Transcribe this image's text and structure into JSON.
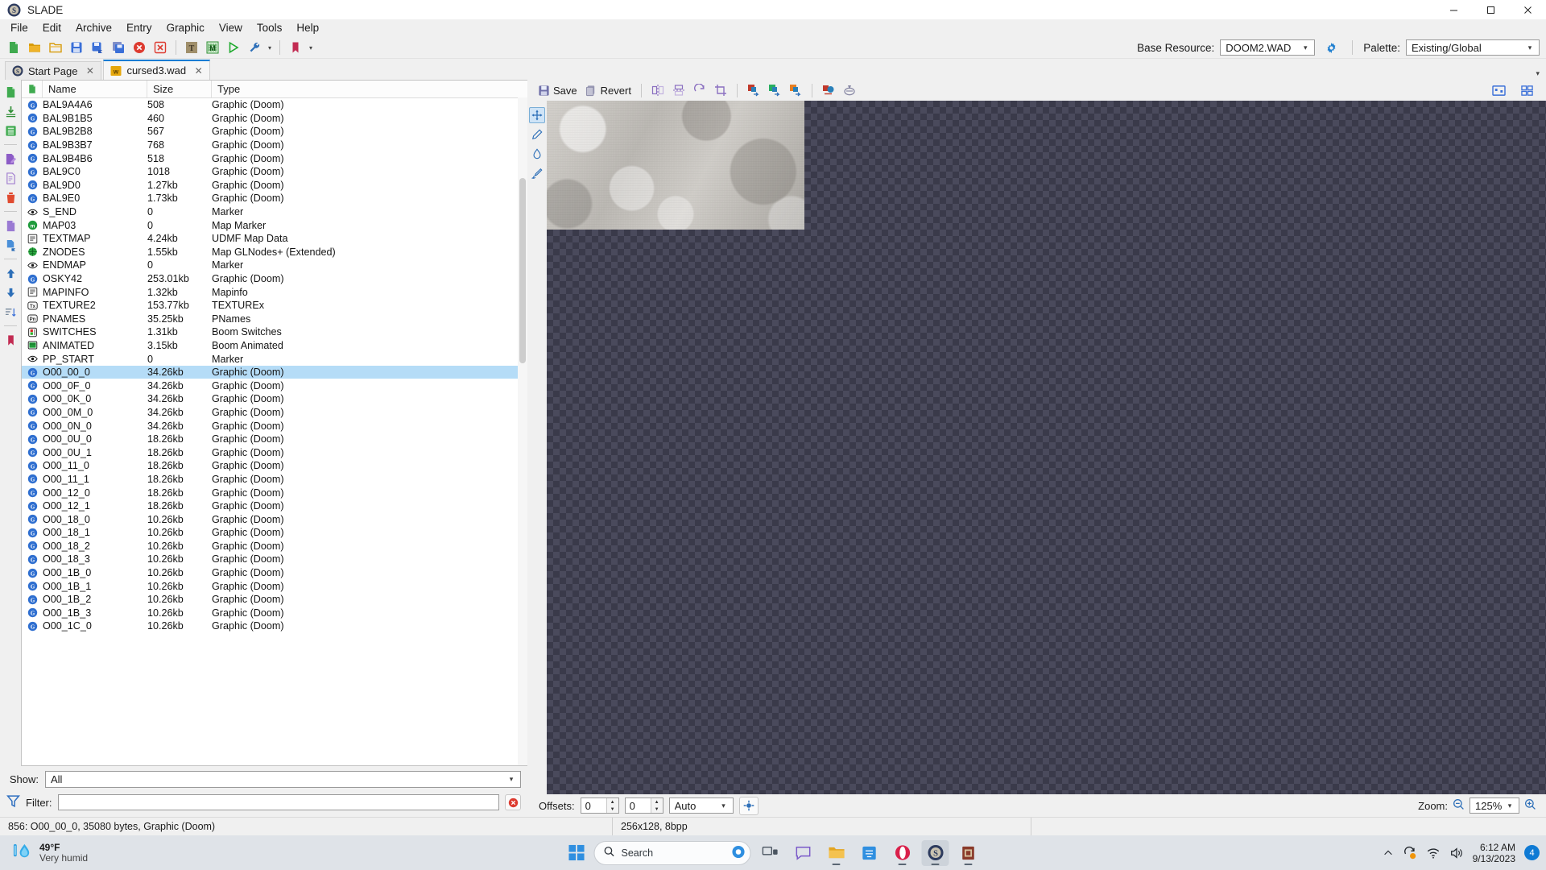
{
  "window": {
    "title": "SLADE",
    "app_icon": "slade-logo-icon",
    "minimize": "–",
    "maximize": "❐",
    "close": "✕"
  },
  "menubar": {
    "items": [
      "File",
      "Edit",
      "Archive",
      "Entry",
      "Graphic",
      "View",
      "Tools",
      "Help"
    ]
  },
  "toolbar": {
    "buttons": [
      {
        "name": "new-archive",
        "icon": "new-file-icon"
      },
      {
        "name": "open-archive",
        "icon": "open-folder-icon"
      },
      {
        "name": "open-directory",
        "icon": "open-folder-outline-icon"
      },
      {
        "name": "save-archive",
        "icon": "save-disk-icon"
      },
      {
        "name": "save-archive-as",
        "icon": "save-as-disk-icon"
      },
      {
        "name": "save-all",
        "icon": "save-all-disk-icon"
      },
      {
        "name": "close-archive",
        "icon": "close-red-circle-icon"
      },
      {
        "name": "close-all-archives",
        "icon": "close-all-red-square-icon"
      },
      {
        "name": "texture-editor",
        "icon": "texture-t-icon"
      },
      {
        "name": "map-editor",
        "icon": "map-m-icon"
      },
      {
        "name": "run-archive",
        "icon": "play-green-icon"
      },
      {
        "name": "preferences",
        "icon": "wrench-icon"
      },
      {
        "name": "bookmarks",
        "icon": "bookmark-red-icon"
      }
    ],
    "base_resource_label": "Base Resource:",
    "base_resource_value": "DOOM2.WAD",
    "base_resource_settings_icon": "gear-icon",
    "palette_label": "Palette:",
    "palette_value": "Existing/Global"
  },
  "tabs": [
    {
      "label": "Start Page",
      "icon": "slade-logo-icon",
      "active": false,
      "close": "✕"
    },
    {
      "label": "cursed3.wad",
      "icon": "wad-archive-icon",
      "active": true,
      "close": "✕"
    }
  ],
  "entry_list": {
    "columns": [
      "Name",
      "Size",
      "Type"
    ],
    "column_icon_header": "entry-icon-column",
    "entries": [
      {
        "icon": "graphic-doom-icon",
        "name": "BAL9A4A6",
        "size": "508",
        "type": "Graphic (Doom)"
      },
      {
        "icon": "graphic-doom-icon",
        "name": "BAL9B1B5",
        "size": "460",
        "type": "Graphic (Doom)"
      },
      {
        "icon": "graphic-doom-icon",
        "name": "BAL9B2B8",
        "size": "567",
        "type": "Graphic (Doom)"
      },
      {
        "icon": "graphic-doom-icon",
        "name": "BAL9B3B7",
        "size": "768",
        "type": "Graphic (Doom)"
      },
      {
        "icon": "graphic-doom-icon",
        "name": "BAL9B4B6",
        "size": "518",
        "type": "Graphic (Doom)"
      },
      {
        "icon": "graphic-doom-icon",
        "name": "BAL9C0",
        "size": "1018",
        "type": "Graphic (Doom)"
      },
      {
        "icon": "graphic-doom-icon",
        "name": "BAL9D0",
        "size": "1.27kb",
        "type": "Graphic (Doom)"
      },
      {
        "icon": "graphic-doom-icon",
        "name": "BAL9E0",
        "size": "1.73kb",
        "type": "Graphic (Doom)"
      },
      {
        "icon": "marker-eye-icon",
        "name": "S_END",
        "size": "0",
        "type": "Marker"
      },
      {
        "icon": "map-marker-icon",
        "name": "MAP03",
        "size": "0",
        "type": "Map Marker"
      },
      {
        "icon": "text-doc-icon",
        "name": "TEXTMAP",
        "size": "4.24kb",
        "type": "UDMF Map Data"
      },
      {
        "icon": "nodes-globe-icon",
        "name": "ZNODES",
        "size": "1.55kb",
        "type": "Map GLNodes+ (Extended)"
      },
      {
        "icon": "marker-eye-icon",
        "name": "ENDMAP",
        "size": "0",
        "type": "Marker"
      },
      {
        "icon": "graphic-doom-icon",
        "name": "OSKY42",
        "size": "253.01kb",
        "type": "Graphic (Doom)"
      },
      {
        "icon": "text-doc-icon",
        "name": "MAPINFO",
        "size": "1.32kb",
        "type": "Mapinfo"
      },
      {
        "icon": "texturex-icon",
        "name": "TEXTURE2",
        "size": "153.77kb",
        "type": "TEXTUREx"
      },
      {
        "icon": "pnames-icon",
        "name": "PNAMES",
        "size": "35.25kb",
        "type": "PNames"
      },
      {
        "icon": "switches-icon",
        "name": "SWITCHES",
        "size": "1.31kb",
        "type": "Boom Switches"
      },
      {
        "icon": "animated-icon",
        "name": "ANIMATED",
        "size": "3.15kb",
        "type": "Boom Animated"
      },
      {
        "icon": "marker-eye-icon",
        "name": "PP_START",
        "size": "0",
        "type": "Marker"
      },
      {
        "icon": "graphic-doom-icon",
        "name": "O00_00_0",
        "size": "34.26kb",
        "type": "Graphic (Doom)",
        "selected": true
      },
      {
        "icon": "graphic-doom-icon",
        "name": "O00_0F_0",
        "size": "34.26kb",
        "type": "Graphic (Doom)"
      },
      {
        "icon": "graphic-doom-icon",
        "name": "O00_0K_0",
        "size": "34.26kb",
        "type": "Graphic (Doom)"
      },
      {
        "icon": "graphic-doom-icon",
        "name": "O00_0M_0",
        "size": "34.26kb",
        "type": "Graphic (Doom)"
      },
      {
        "icon": "graphic-doom-icon",
        "name": "O00_0N_0",
        "size": "34.26kb",
        "type": "Graphic (Doom)"
      },
      {
        "icon": "graphic-doom-icon",
        "name": "O00_0U_0",
        "size": "18.26kb",
        "type": "Graphic (Doom)"
      },
      {
        "icon": "graphic-doom-icon",
        "name": "O00_0U_1",
        "size": "18.26kb",
        "type": "Graphic (Doom)"
      },
      {
        "icon": "graphic-doom-icon",
        "name": "O00_11_0",
        "size": "18.26kb",
        "type": "Graphic (Doom)"
      },
      {
        "icon": "graphic-doom-icon",
        "name": "O00_11_1",
        "size": "18.26kb",
        "type": "Graphic (Doom)"
      },
      {
        "icon": "graphic-doom-icon",
        "name": "O00_12_0",
        "size": "18.26kb",
        "type": "Graphic (Doom)"
      },
      {
        "icon": "graphic-doom-icon",
        "name": "O00_12_1",
        "size": "18.26kb",
        "type": "Graphic (Doom)"
      },
      {
        "icon": "graphic-doom-icon",
        "name": "O00_18_0",
        "size": "10.26kb",
        "type": "Graphic (Doom)"
      },
      {
        "icon": "graphic-doom-icon",
        "name": "O00_18_1",
        "size": "10.26kb",
        "type": "Graphic (Doom)"
      },
      {
        "icon": "graphic-doom-icon",
        "name": "O00_18_2",
        "size": "10.26kb",
        "type": "Graphic (Doom)"
      },
      {
        "icon": "graphic-doom-icon",
        "name": "O00_18_3",
        "size": "10.26kb",
        "type": "Graphic (Doom)"
      },
      {
        "icon": "graphic-doom-icon",
        "name": "O00_1B_0",
        "size": "10.26kb",
        "type": "Graphic (Doom)"
      },
      {
        "icon": "graphic-doom-icon",
        "name": "O00_1B_1",
        "size": "10.26kb",
        "type": "Graphic (Doom)"
      },
      {
        "icon": "graphic-doom-icon",
        "name": "O00_1B_2",
        "size": "10.26kb",
        "type": "Graphic (Doom)"
      },
      {
        "icon": "graphic-doom-icon",
        "name": "O00_1B_3",
        "size": "10.26kb",
        "type": "Graphic (Doom)"
      },
      {
        "icon": "graphic-doom-icon",
        "name": "O00_1C_0",
        "size": "10.26kb",
        "type": "Graphic (Doom)"
      }
    ]
  },
  "entry_sidebar": {
    "buttons": [
      {
        "name": "new-entry",
        "icon": "new-entry-icon"
      },
      {
        "name": "import-entry",
        "icon": "import-down-arrow-icon"
      },
      {
        "name": "import-files",
        "icon": "import-files-green-icon"
      },
      {
        "name": "rename-entry",
        "icon": "rename-purple-icon"
      },
      {
        "name": "edit-entry",
        "icon": "edit-doc-purple-icon"
      },
      {
        "name": "delete-entry",
        "icon": "trash-red-icon"
      },
      {
        "name": "export-entry",
        "icon": "export-doc-icon"
      },
      {
        "name": "export-entry-as",
        "icon": "export-doc-arrow-icon"
      },
      {
        "name": "move-up",
        "icon": "arrow-up-blue-icon"
      },
      {
        "name": "move-down",
        "icon": "arrow-down-blue-icon"
      },
      {
        "name": "sort-entries",
        "icon": "sort-icon"
      },
      {
        "name": "bookmark-entry",
        "icon": "bookmark-red-icon"
      }
    ]
  },
  "filter_panel": {
    "show_label": "Show:",
    "show_value": "All",
    "filter_label": "Filter:",
    "filter_value": "",
    "filter_icon": "filter-funnel-icon",
    "clear_icon": "clear-red-circle-icon"
  },
  "gfx_toolbar": {
    "save_label": "Save",
    "save_icon": "save-disk-icon",
    "revert_label": "Revert",
    "revert_icon": "revert-icon",
    "buttons": [
      {
        "name": "mirror-horizontal",
        "icon": "mirror-horizontal-icon"
      },
      {
        "name": "mirror-vertical",
        "icon": "mirror-vertical-icon"
      },
      {
        "name": "rotate",
        "icon": "rotate-icon"
      },
      {
        "name": "crop",
        "icon": "crop-icon"
      },
      {
        "name": "convert-to-doom-gfx",
        "icon": "convert-doom-icon"
      },
      {
        "name": "convert-to-png",
        "icon": "convert-png-icon"
      },
      {
        "name": "convert-format",
        "icon": "convert-format-icon"
      },
      {
        "name": "remap-palette",
        "icon": "remap-palette-icon"
      },
      {
        "name": "translate-colours",
        "icon": "translate-colours-icon"
      }
    ],
    "right_buttons": [
      {
        "name": "toggle-image-panel",
        "icon": "image-panel-icon"
      },
      {
        "name": "toggle-grid-panel",
        "icon": "grid-panel-icon"
      }
    ]
  },
  "canvas_tools": [
    {
      "name": "pan-tool",
      "icon": "move-crosshair-icon",
      "active": true
    },
    {
      "name": "draw-tool",
      "icon": "pencil-icon",
      "active": false
    },
    {
      "name": "fill-tool",
      "icon": "paint-drop-icon",
      "active": false
    },
    {
      "name": "brush-tool",
      "icon": "brush-icon",
      "active": false
    }
  ],
  "offset_bar": {
    "label": "Offsets:",
    "x_value": "0",
    "y_value": "0",
    "type_value": "Auto",
    "aim_icon": "offset-target-icon",
    "zoom_label": "Zoom:",
    "zoom_value": "125%",
    "zoom_out_icon": "zoom-out-icon",
    "zoom_in_icon": "zoom-in-icon"
  },
  "statusbar": {
    "left": "856: O00_00_0, 35080 bytes, Graphic (Doom)",
    "middle": "256x128, 8bpp",
    "right": ""
  },
  "taskbar": {
    "weather_temp": "49°F",
    "weather_desc": "Very humid",
    "weather_icon": "humidity-drop-icon",
    "start_icon": "windows-start-icon",
    "search_icon": "search-icon",
    "search_text": "Search",
    "search_badge_icon": "copilot-badge-icon",
    "apps": [
      {
        "name": "task-view",
        "icon": "task-view-icon",
        "active": false,
        "running": false
      },
      {
        "name": "chat-teams",
        "icon": "chat-bubble-icon",
        "active": false,
        "running": false
      },
      {
        "name": "file-explorer",
        "icon": "file-explorer-icon",
        "active": false,
        "running": true
      },
      {
        "name": "store",
        "icon": "microsoft-store-icon",
        "active": false,
        "running": false
      },
      {
        "name": "opera-browser",
        "icon": "opera-icon",
        "active": false,
        "running": true
      },
      {
        "name": "slade-app",
        "icon": "slade-logo-icon",
        "active": true,
        "running": true
      },
      {
        "name": "doom-builder",
        "icon": "doom-builder-icon",
        "active": false,
        "running": true
      }
    ],
    "tray": {
      "chevron_icon": "chevron-up-icon",
      "update_icon": "windows-update-icon",
      "wifi_icon": "wifi-icon",
      "volume_icon": "speaker-icon",
      "time": "6:12 AM",
      "date": "9/13/2023",
      "notification_count": "4"
    }
  },
  "colors": {
    "accent_blue": "#0a7cd4",
    "selection_blue": "#b5dcf7",
    "chrome_grey": "#f0f0f0",
    "taskbar": "#dfe3e8",
    "canvas_dark": "#3a3a4a"
  }
}
